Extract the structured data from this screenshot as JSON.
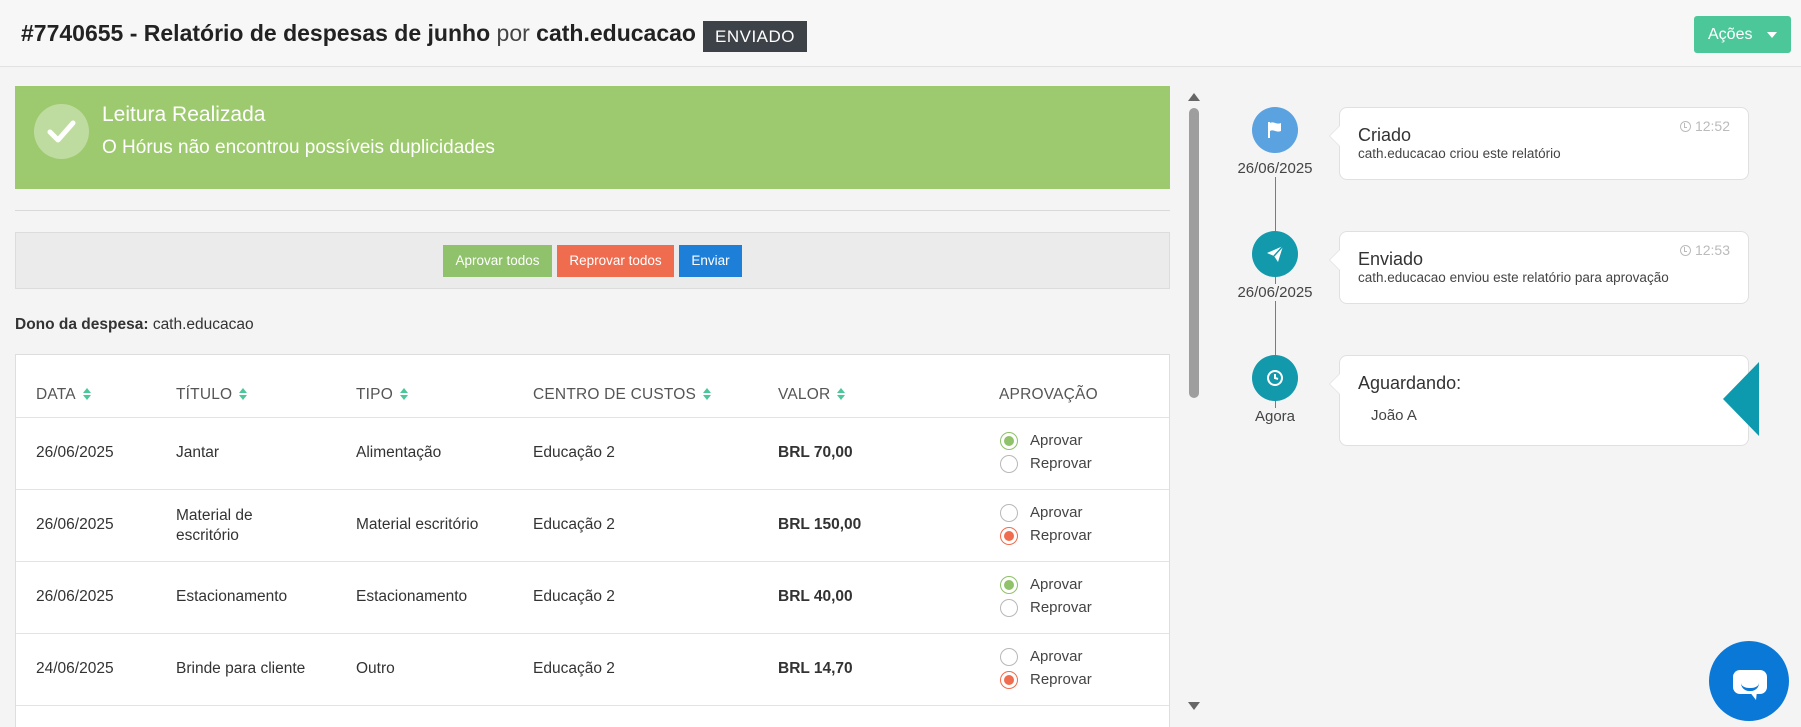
{
  "header": {
    "report_id": "#7740655 - Relatório de despesas de junho",
    "por": "por",
    "owner": "cath.educacao",
    "status": "ENVIADO",
    "actions_label": "Ações"
  },
  "alert": {
    "title": "Leitura Realizada",
    "message": "O Hórus não encontrou possíveis duplicidades"
  },
  "actions": {
    "approve_all": "Aprovar todos",
    "reject_all": "Reprovar todos",
    "send": "Enviar"
  },
  "expense_owner": {
    "label": "Dono da despesa:",
    "value": "cath.educacao"
  },
  "table": {
    "columns": [
      "DATA",
      "TÍTULO",
      "TIPO",
      "CENTRO DE CUSTOS",
      "VALOR",
      "APROVAÇÃO"
    ],
    "radio_labels": {
      "approve": "Aprovar",
      "reject": "Reprovar"
    },
    "rows": [
      {
        "data": "26/06/2025",
        "titulo": "Jantar",
        "tipo": "Alimentação",
        "centro": "Educação 2",
        "valor": "BRL 70,00",
        "aprovacao": "approve"
      },
      {
        "data": "26/06/2025",
        "titulo": "Material de escritório",
        "tipo": "Material escritório",
        "centro": "Educação 2",
        "valor": "BRL 150,00",
        "aprovacao": "reject"
      },
      {
        "data": "26/06/2025",
        "titulo": "Estacionamento",
        "tipo": "Estacionamento",
        "centro": "Educação 2",
        "valor": "BRL 40,00",
        "aprovacao": "approve"
      },
      {
        "data": "24/06/2025",
        "titulo": "Brinde para cliente",
        "tipo": "Outro",
        "centro": "Educação 2",
        "valor": "BRL 14,70",
        "aprovacao": "reject"
      }
    ]
  },
  "timeline": {
    "events": [
      {
        "icon": "flag-icon",
        "color": "#5aa2e0",
        "date": "26/06/2025",
        "title": "Criado",
        "description": "cath.educacao criou este relatório",
        "time": "12:52"
      },
      {
        "icon": "paper-plane-icon",
        "color": "#1399ac",
        "date": "26/06/2025",
        "title": "Enviado",
        "description": "cath.educacao enviou este relatório para aprovação",
        "time": "12:53"
      }
    ],
    "pending": {
      "icon": "clock-icon",
      "color": "#1399ac",
      "date": "Agora",
      "title": "Aguardando:",
      "approver": "João A"
    }
  },
  "colors": {
    "alert_green": "#9dca6e",
    "accent_teal": "#4cc79a",
    "reject_red": "#f06c4f",
    "send_blue": "#1e7fd8",
    "chat_blue": "#0a78d6"
  }
}
